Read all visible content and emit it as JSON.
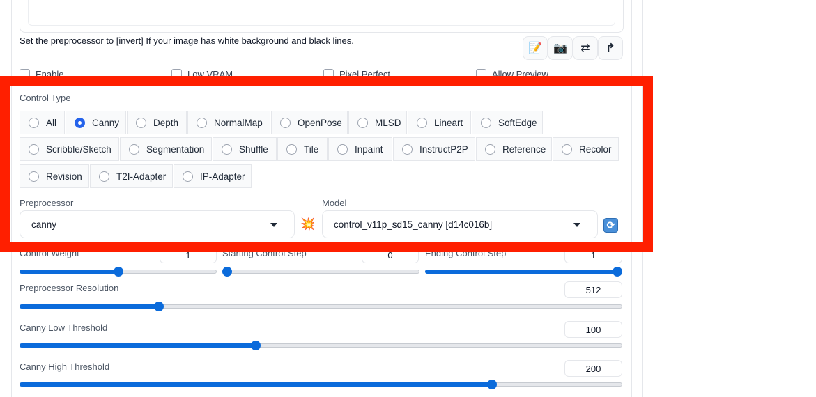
{
  "hint_text": "Set the preprocessor to [invert] If your image has white background and black lines.",
  "toolbar": {
    "icons": [
      "edit-icon",
      "camera-icon",
      "swap-icon",
      "upload-icon"
    ]
  },
  "checkboxes": {
    "enable": "Enable",
    "low_vram": "Low VRAM",
    "pixel_perfect": "Pixel Perfect",
    "allow_preview": "Allow Preview"
  },
  "control_type": {
    "label": "Control Type",
    "selected": "Canny",
    "options": [
      "All",
      "Canny",
      "Depth",
      "NormalMap",
      "OpenPose",
      "MLSD",
      "Lineart",
      "SoftEdge",
      "Scribble/Sketch",
      "Segmentation",
      "Shuffle",
      "Tile",
      "Inpaint",
      "InstructP2P",
      "Reference",
      "Recolor",
      "Revision",
      "T2I-Adapter",
      "IP-Adapter"
    ]
  },
  "preprocessor": {
    "label": "Preprocessor",
    "value": "canny"
  },
  "model": {
    "label": "Model",
    "value": "control_v11p_sd15_canny [d14c016b]"
  },
  "sliders": {
    "control_weight": {
      "label": "Control Weight",
      "value": "1",
      "fraction": 0.5
    },
    "starting_step": {
      "label": "Starting Control Step",
      "value": "0",
      "fraction": 0.0
    },
    "ending_step": {
      "label": "Ending Control Step",
      "value": "1",
      "fraction": 1.0
    },
    "preprocessor_resolution": {
      "label": "Preprocessor Resolution",
      "value": "512",
      "fraction": 0.231
    },
    "canny_low": {
      "label": "Canny Low Threshold",
      "value": "100",
      "fraction": 0.392
    },
    "canny_high": {
      "label": "Canny High Threshold",
      "value": "200",
      "fraction": 0.784
    }
  },
  "colors": {
    "accent": "#0b6bdb",
    "highlight": "#ff1f00",
    "radio_selected": "#2563eb"
  }
}
